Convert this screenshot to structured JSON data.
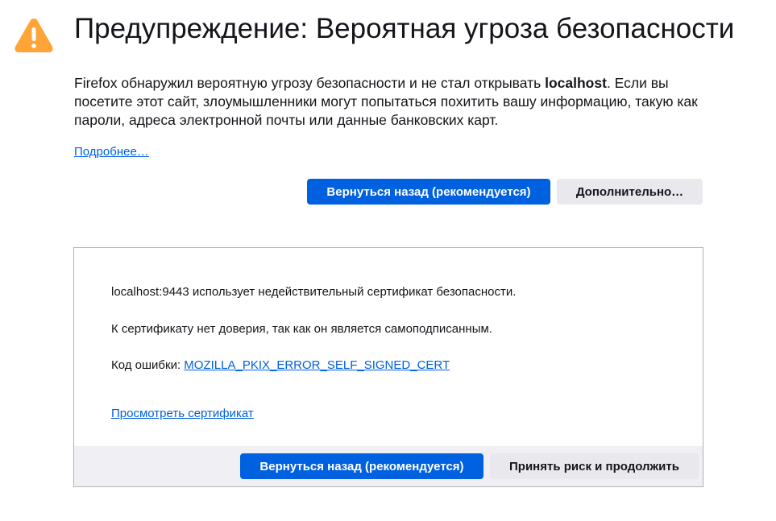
{
  "icon": "warning-triangle-icon",
  "colors": {
    "accent": "#0061e0",
    "warning": "#ffa436",
    "secondary_button": "#e9e9ed"
  },
  "title": "Предупреждение: Вероятная угроза безопасности",
  "intro": {
    "before": "Firefox обнаружил вероятную угрозу безопасности и не стал открывать ",
    "host": "localhost",
    "after": ". Если вы посетите этот сайт, злоумышленники могут попытаться похитить вашу информацию, такую как пароли, адреса электронной почты или данные банковских карт."
  },
  "learn_more": "Подробнее…",
  "buttons": {
    "go_back": "Вернуться назад (рекомендуется)",
    "advanced": "Дополнительно…"
  },
  "advanced_panel": {
    "line1": "localhost:9443 использует недействительный сертификат безопасности.",
    "line2": "К сертификату нет доверия, так как он является самоподписанным.",
    "error_label": "Код ошибки: ",
    "error_code": "MOZILLA_PKIX_ERROR_SELF_SIGNED_CERT",
    "view_cert": "Просмотреть сертификат",
    "go_back": "Вернуться назад (рекомендуется)",
    "accept": "Принять риск и продолжить"
  }
}
